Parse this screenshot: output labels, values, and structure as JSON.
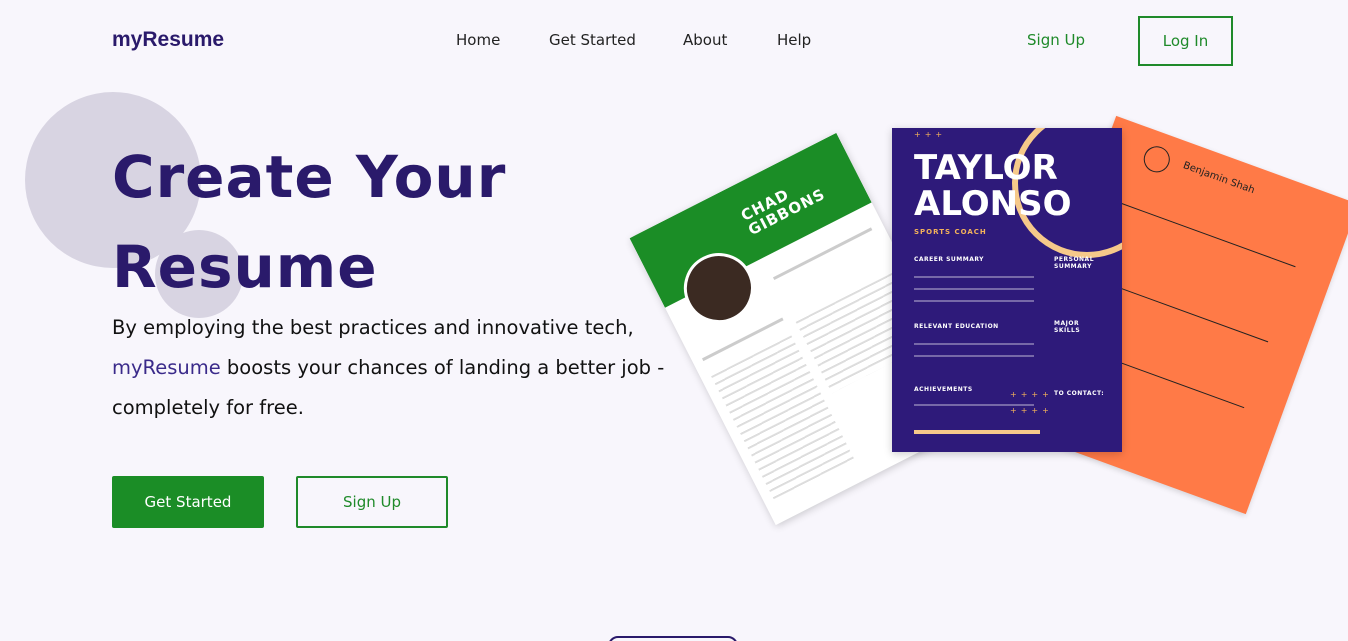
{
  "brand": "myResume",
  "nav": {
    "home": "Home",
    "get_started": "Get Started",
    "about": "About",
    "help": "Help",
    "sign_up": "Sign Up",
    "log_in": "Log In"
  },
  "hero": {
    "title_line1": "Create Your",
    "title_line2": "Resume",
    "desc_before": "By employing the best practices and innovative tech, ",
    "desc_brand": "myResume",
    "desc_after": " boosts your chances of landing a better job - completely for free.",
    "btn_get_started": "Get Started",
    "btn_sign_up": "Sign Up"
  },
  "resumes": {
    "white_name": "CHAD GIBBONS",
    "purple_name_1": "TAYLOR",
    "purple_name_2": "ALONSO",
    "purple_role": "SPORTS COACH",
    "purple_sections": [
      "CAREER SUMMARY",
      "PERSONAL SUMMARY",
      "RELEVANT EDUCATION",
      "MAJOR SKILLS",
      "ACHIEVEMENTS",
      "TO CONTACT:"
    ],
    "orange_name": "Benjamin Shah"
  },
  "colors": {
    "brand": "#2a1a6b",
    "accent_green": "#1b8d26",
    "background": "#f8f6fc"
  }
}
